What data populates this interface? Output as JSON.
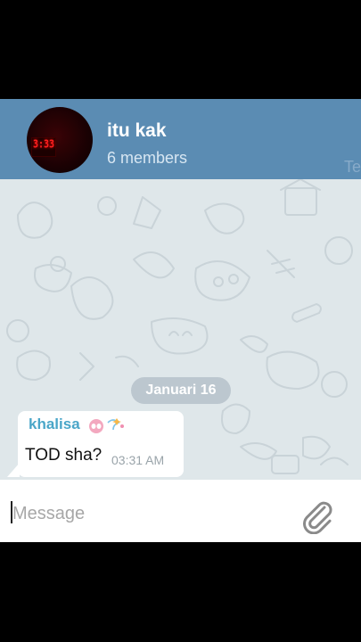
{
  "header": {
    "title": "itu kak",
    "subtitle": "6 members",
    "corner_text": "Te",
    "avatar_clock": "3:33"
  },
  "chat": {
    "date_label": "Januari 16",
    "messages": [
      {
        "sender": "khalisa",
        "text": "TOD sha?",
        "time": "03:31 AM"
      }
    ]
  },
  "composer": {
    "placeholder": "Message"
  },
  "colors": {
    "header_bg": "#5b8cb3",
    "chat_bg": "#dfe7ea",
    "sender_name": "#4aa6c8",
    "date_pill": "#bcc7cf"
  },
  "icons": {
    "attach": "paperclip-icon"
  }
}
